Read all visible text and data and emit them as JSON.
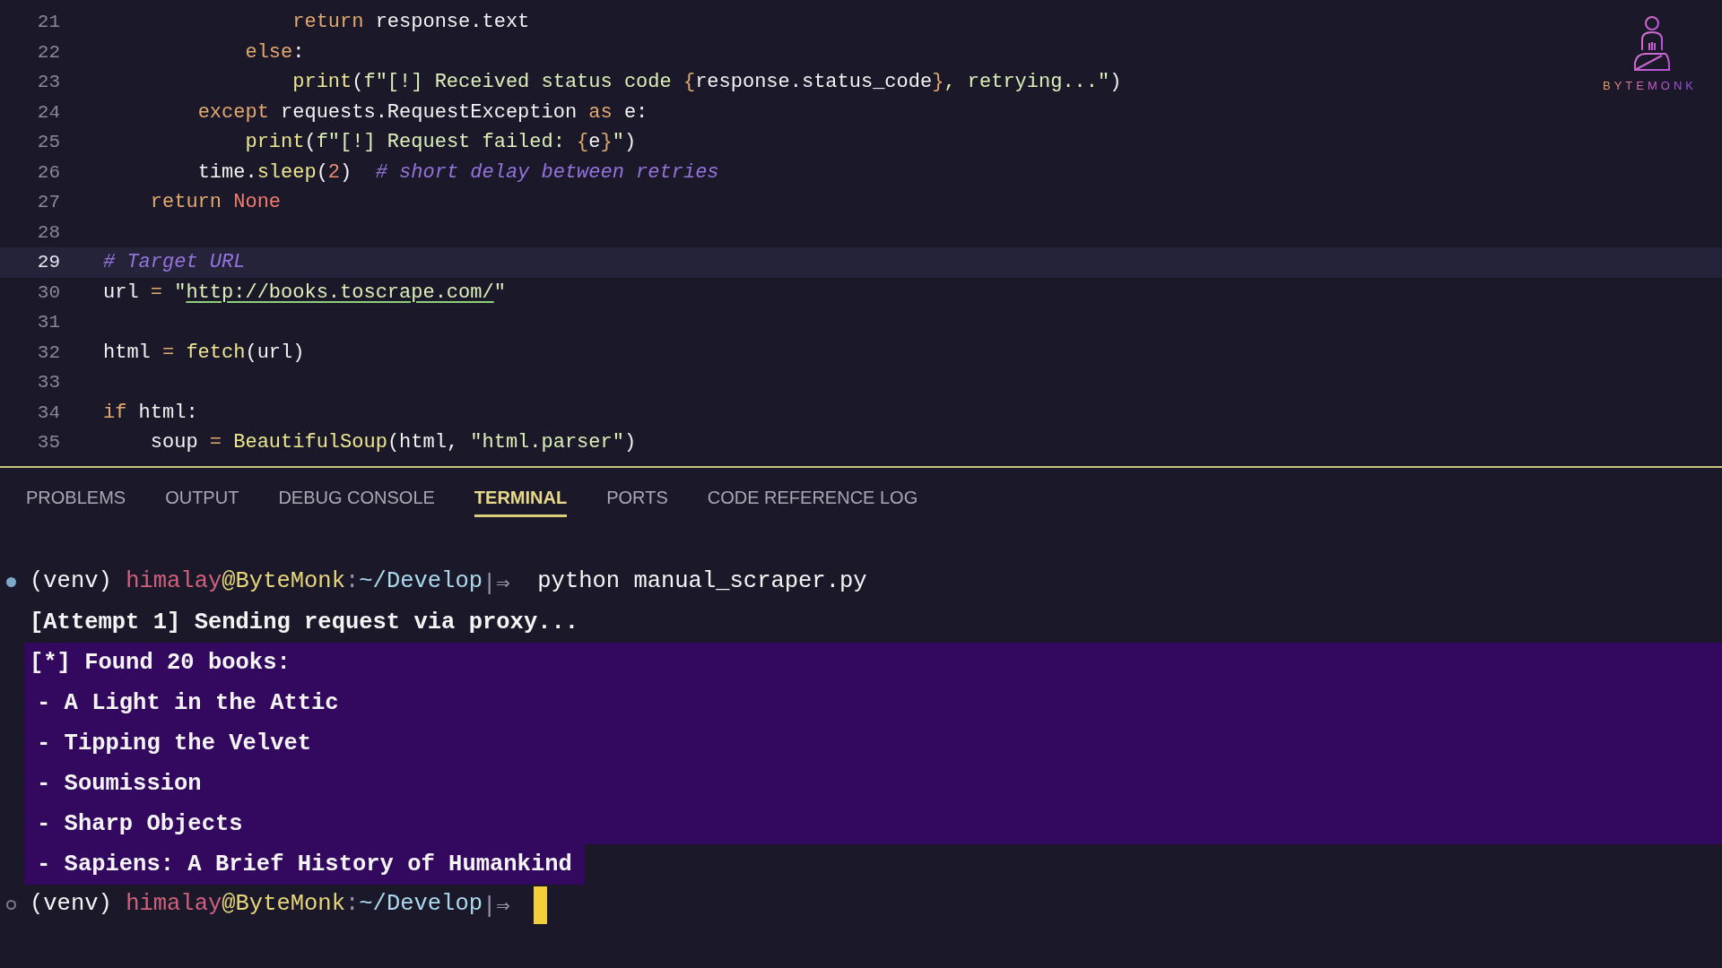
{
  "logo": {
    "wordmark": "BYTEMONK"
  },
  "editor": {
    "lines": [
      {
        "number": "21",
        "current": false,
        "tokens": [
          {
            "text": "                return",
            "kind": "keyword"
          },
          {
            "text": " response.text",
            "kind": "plain"
          }
        ]
      },
      {
        "number": "22",
        "current": false,
        "tokens": [
          {
            "text": "            else",
            "kind": "keyword"
          },
          {
            "text": ":",
            "kind": "plain"
          }
        ]
      },
      {
        "number": "23",
        "current": false,
        "tokens": [
          {
            "text": "                print",
            "kind": "function"
          },
          {
            "text": "(",
            "kind": "plain"
          },
          {
            "text": "f\"[!] Received status code ",
            "kind": "string"
          },
          {
            "text": "{",
            "kind": "brace"
          },
          {
            "text": "response.status_code",
            "kind": "plain"
          },
          {
            "text": "}",
            "kind": "brace"
          },
          {
            "text": ", retrying...\"",
            "kind": "string"
          },
          {
            "text": ")",
            "kind": "plain"
          }
        ]
      },
      {
        "number": "24",
        "current": false,
        "tokens": [
          {
            "text": "        except",
            "kind": "keyword"
          },
          {
            "text": " requests.RequestException ",
            "kind": "plain"
          },
          {
            "text": "as",
            "kind": "keyword"
          },
          {
            "text": " e:",
            "kind": "plain"
          }
        ]
      },
      {
        "number": "25",
        "current": false,
        "tokens": [
          {
            "text": "            print",
            "kind": "function"
          },
          {
            "text": "(",
            "kind": "plain"
          },
          {
            "text": "f\"[!] Request failed: ",
            "kind": "string"
          },
          {
            "text": "{",
            "kind": "brace"
          },
          {
            "text": "e",
            "kind": "plain"
          },
          {
            "text": "}",
            "kind": "brace"
          },
          {
            "text": "\"",
            "kind": "string"
          },
          {
            "text": ")",
            "kind": "plain"
          }
        ]
      },
      {
        "number": "26",
        "current": false,
        "tokens": [
          {
            "text": "        time.",
            "kind": "plain"
          },
          {
            "text": "sleep",
            "kind": "function"
          },
          {
            "text": "(",
            "kind": "plain"
          },
          {
            "text": "2",
            "kind": "number"
          },
          {
            "text": ")  ",
            "kind": "plain"
          },
          {
            "text": "# short delay between retries",
            "kind": "comment"
          }
        ]
      },
      {
        "number": "27",
        "current": false,
        "tokens": [
          {
            "text": "    return ",
            "kind": "keyword"
          },
          {
            "text": "None",
            "kind": "constant"
          }
        ]
      },
      {
        "number": "28",
        "current": false
      },
      {
        "number": "29",
        "current": true,
        "tokens": [
          {
            "text": "# Target URL",
            "kind": "comment"
          }
        ]
      },
      {
        "number": "30",
        "current": false,
        "tokens": [
          {
            "text": "url ",
            "kind": "plain"
          },
          {
            "text": "=",
            "kind": "operator"
          },
          {
            "text": " \"",
            "kind": "string"
          },
          {
            "text": "http://books.toscrape.com/",
            "kind": "link"
          },
          {
            "text": "\"",
            "kind": "string"
          }
        ]
      },
      {
        "number": "31",
        "current": false
      },
      {
        "number": "32",
        "current": false,
        "tokens": [
          {
            "text": "html ",
            "kind": "plain"
          },
          {
            "text": "= ",
            "kind": "operator"
          },
          {
            "text": "fetch",
            "kind": "function"
          },
          {
            "text": "(url)",
            "kind": "plain"
          }
        ]
      },
      {
        "number": "33",
        "current": false
      },
      {
        "number": "34",
        "current": false,
        "tokens": [
          {
            "text": "if",
            "kind": "keyword"
          },
          {
            "text": " html:",
            "kind": "plain"
          }
        ]
      },
      {
        "number": "35",
        "current": false,
        "tokens": [
          {
            "text": "    soup ",
            "kind": "plain"
          },
          {
            "text": "= ",
            "kind": "operator"
          },
          {
            "text": "BeautifulSoup",
            "kind": "function"
          },
          {
            "text": "(html, ",
            "kind": "plain"
          },
          {
            "text": "\"html.parser\"",
            "kind": "string"
          },
          {
            "text": ")",
            "kind": "plain"
          }
        ]
      }
    ]
  },
  "panel": {
    "tabs": [
      {
        "label": "PROBLEMS",
        "selected": false
      },
      {
        "label": "OUTPUT",
        "selected": false
      },
      {
        "label": "DEBUG CONSOLE",
        "selected": false
      },
      {
        "label": "TERMINAL",
        "selected": true
      },
      {
        "label": "PORTS",
        "selected": false
      },
      {
        "label": "CODE REFERENCE LOG",
        "selected": false
      }
    ]
  },
  "terminal": {
    "lines": [
      {
        "kind": "prompt",
        "done": true,
        "cursor": false,
        "selected": false,
        "segments": [
          {
            "text": "(venv) ",
            "kind": "plain"
          },
          {
            "text": "himalay",
            "kind": "user"
          },
          {
            "text": "@ByteMonk",
            "kind": "host"
          },
          {
            "text": ":",
            "kind": "sep"
          },
          {
            "text": "~/Develop",
            "kind": "path"
          },
          {
            "text": "|⇒",
            "kind": "sep"
          },
          {
            "text": "  python manual_scraper.py",
            "kind": "plain"
          }
        ]
      },
      {
        "kind": "output",
        "selected": false,
        "text": "[Attempt 1] Sending request via proxy..."
      },
      {
        "kind": "output",
        "selected": true,
        "text": "[*] Found 20 books:"
      },
      {
        "kind": "item",
        "selected": true,
        "text": "- A Light in the Attic"
      },
      {
        "kind": "item",
        "selected": true,
        "text": "- Tipping the Velvet"
      },
      {
        "kind": "item",
        "selected": true,
        "text": "- Soumission"
      },
      {
        "kind": "item",
        "selected": true,
        "text": "- Sharp Objects"
      },
      {
        "kind": "item",
        "selected": true,
        "text": "- Sapiens: A Brief History of Humankind"
      },
      {
        "kind": "prompt",
        "done": false,
        "cursor": true,
        "selected": false,
        "segments": [
          {
            "text": "(venv) ",
            "kind": "plain"
          },
          {
            "text": "himalay",
            "kind": "user"
          },
          {
            "text": "@ByteMonk",
            "kind": "host"
          },
          {
            "text": ":",
            "kind": "sep"
          },
          {
            "text": "~/Develop",
            "kind": "path"
          },
          {
            "text": "|⇒",
            "kind": "sep"
          }
        ]
      }
    ]
  }
}
